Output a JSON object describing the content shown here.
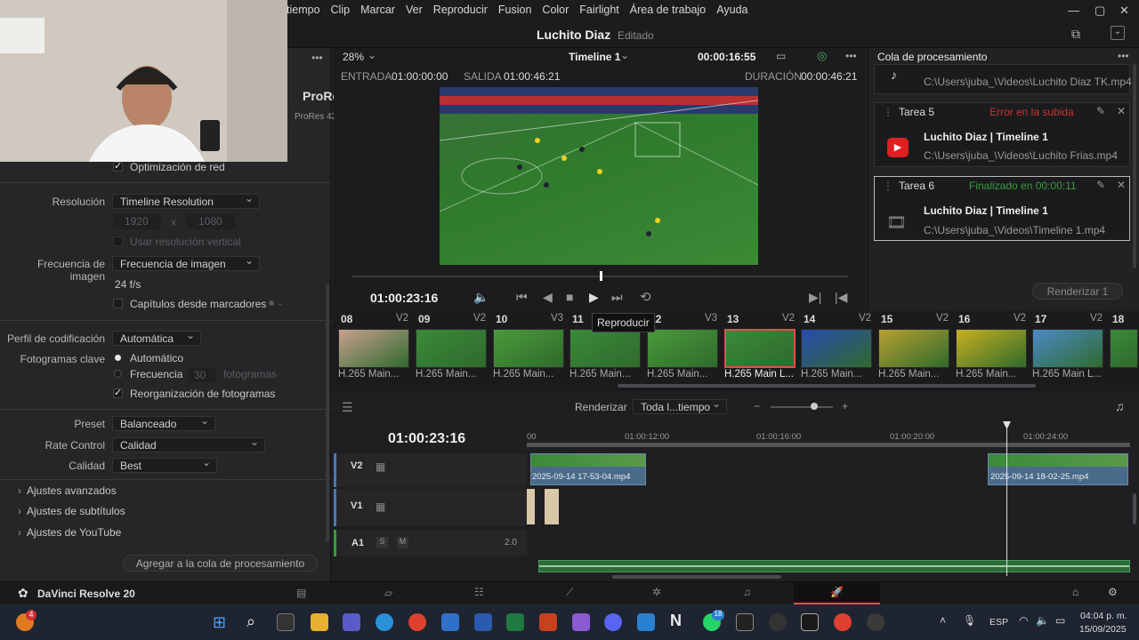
{
  "menubar": {
    "items": [
      "tiempo",
      "Clip",
      "Marcar",
      "Ver",
      "Reproducir",
      "Fusion",
      "Color",
      "Fairlight",
      "Área de trabajo",
      "Ayuda"
    ]
  },
  "titlebar": {
    "project": "Luchito Diaz",
    "status": "Editado"
  },
  "left": {
    "preset_name": "ProRe",
    "preset_sub": "ProRes 42",
    "network_opt": "Optimización de red",
    "resolution_label": "Resolución",
    "resolution_value": "Timeline Resolution",
    "width": "1920",
    "x": "x",
    "height": "1080",
    "vertical": "Usar resolución vertical",
    "framerate_label": "Frecuencia de imagen",
    "framerate_value": "Frecuencia de imagen",
    "fps": "24 f/s",
    "chapters": "Capítulos desde marcadores",
    "profile_label": "Perfil de codificación",
    "profile_value": "Automática",
    "keyframes_label": "Fotogramas clave",
    "kf_auto": "Automático",
    "kf_freq": "Frecuencia",
    "kf_num": "30",
    "kf_unit": "fotogramas",
    "reorder": "Reorganización de fotogramas",
    "preset_label": "Preset",
    "preset_value": "Balanceado",
    "rate_label": "Rate Control",
    "rate_value": "Calidad",
    "quality_label": "Calidad",
    "quality_value": "Best",
    "adv": "Ajustes avanzados",
    "subs": "Ajustes de subtítulos",
    "youtube": "Ajustes de YouTube",
    "add_queue": "Agregar a la cola de procesamiento"
  },
  "viewer": {
    "zoom": "28%",
    "timeline": "Timeline 1",
    "timecode": "00:00:16:55",
    "in_label": "ENTRADA",
    "in_val": "01:00:00:00",
    "out_label": "SALIDA",
    "out_val": "01:00:46:21",
    "dur_label": "DURACIÓN",
    "dur_val": "00:00:46:21",
    "play_tc": "01:00:23:16",
    "tooltip": "Reproducir"
  },
  "queue": {
    "title": "Cola de procesamiento",
    "job_top_path": "C:\\Users\\juba_\\Videos\\Luchito Diaz TK.mp4",
    "job5": {
      "name": "Tarea 5",
      "status": "Error en la subida",
      "title": "Luchito Diaz | Timeline 1",
      "path": "C:\\Users\\juba_\\Videos\\Luchito Frias.mp4"
    },
    "job6": {
      "name": "Tarea 6",
      "status": "Finalizado en 00:00:11",
      "title": "Luchito Diaz | Timeline 1",
      "path": "C:\\Users\\juba_\\Videos\\Timeline 1.mp4"
    },
    "render_btn": "Renderizar 1"
  },
  "clips": [
    {
      "num": "08",
      "track": "V2",
      "cap": "H.265 Main..."
    },
    {
      "num": "09",
      "track": "V2",
      "cap": "H.265 Main..."
    },
    {
      "num": "10",
      "track": "V3",
      "cap": "H.265 Main..."
    },
    {
      "num": "11",
      "track": "",
      "cap": "H.265 Main..."
    },
    {
      "num": "12",
      "track": "V3",
      "cap": "H.265 Main..."
    },
    {
      "num": "13",
      "track": "V2",
      "cap": "H.265 Main L..."
    },
    {
      "num": "14",
      "track": "V2",
      "cap": "H.265 Main..."
    },
    {
      "num": "15",
      "track": "V2",
      "cap": "H.265 Main..."
    },
    {
      "num": "16",
      "track": "V2",
      "cap": "H.265 Main..."
    },
    {
      "num": "17",
      "track": "V2",
      "cap": "H.265 Main L..."
    },
    {
      "num": "18",
      "track": "",
      "cap": ""
    }
  ],
  "timeline": {
    "render_label": "Renderizar",
    "render_value": "Toda l...tiempo",
    "tc": "01:00:23:16",
    "ruler": [
      "00",
      "01:00:12:00",
      "01:00:16:00",
      "01:00:20:00",
      "01:00:24:00"
    ],
    "tracks": [
      "V2",
      "V1",
      "A1"
    ],
    "a1_level": "2.0",
    "a1_s": "S",
    "a1_m": "M",
    "clip1": "2025-09-14 17-53-04.mp4",
    "clip2": "2025-09-14 18-02-25.mp4"
  },
  "bottom": {
    "app": "DaVinci Resolve 20"
  },
  "taskbar": {
    "lang": "ESP",
    "time": "04:04 p. m.",
    "date": "15/09/2025",
    "badge1": "4",
    "badge2": "18"
  },
  "colors": {
    "accent": "#e05050",
    "ok": "#3a9a3a",
    "error": "#d03030"
  }
}
